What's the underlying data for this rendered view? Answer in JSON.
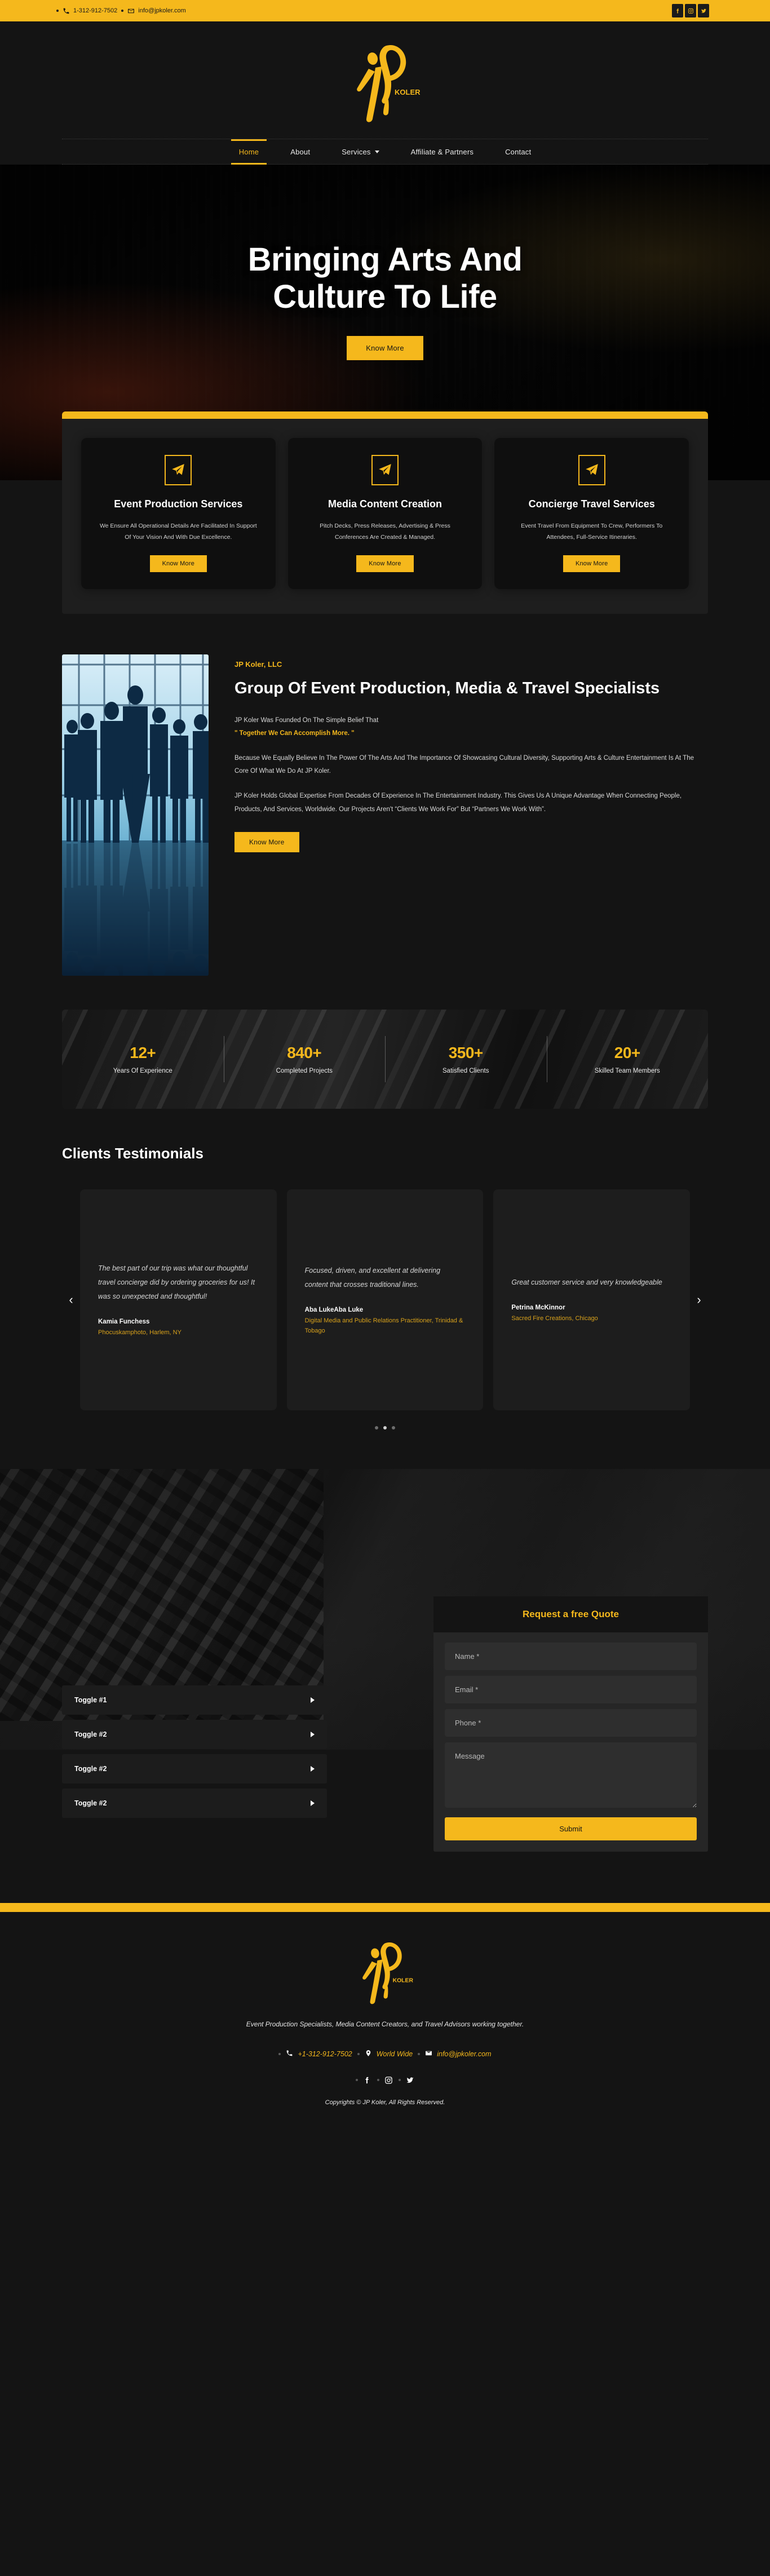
{
  "brand": {
    "name": "JP Koler",
    "logo_text": "KOLER",
    "accent": "#F5B81C"
  },
  "topbar": {
    "phone": "1-312-912-7502",
    "email": "info@jpkoler.com",
    "social": [
      {
        "name": "facebook",
        "label": "f"
      },
      {
        "name": "instagram",
        "label": "o"
      },
      {
        "name": "twitter",
        "label": "t"
      }
    ]
  },
  "nav": {
    "items": [
      {
        "label": "Home",
        "active": true
      },
      {
        "label": "About",
        "active": false
      },
      {
        "label": "Services",
        "active": false,
        "has_dropdown": true
      },
      {
        "label": "Affiliate & Partners",
        "active": false
      },
      {
        "label": "Contact",
        "active": false
      }
    ]
  },
  "hero": {
    "line1": "Bringing Arts And",
    "line2": "Culture To Life",
    "cta": "Know More"
  },
  "services": {
    "cards": [
      {
        "icon": "paper-plane-icon",
        "title": "Event Production Services",
        "desc": "We Ensure All Operational Details Are Facilitated In Support Of Your Vision And With Due Excellence.",
        "cta": "Know More"
      },
      {
        "icon": "paper-plane-icon",
        "title": "Media Content Creation",
        "desc": "Pitch Decks, Press Releases, Advertising & Press Conferences Are Created & Managed.",
        "cta": "Know More"
      },
      {
        "icon": "paper-plane-icon",
        "title": "Concierge Travel Services",
        "desc": "Event Travel From Equipment To Crew, Performers To Attendees, Full-Service Itineraries.",
        "cta": "Know More"
      }
    ]
  },
  "about": {
    "eyebrow": "JP Koler, LLC",
    "heading": "Group Of Event Production, Media & Travel Specialists",
    "intro_prefix": "JP Koler Was Founded On The Simple Belief That",
    "intro_quote": "\" Together We Can Accomplish More. \"",
    "paragraph2": "Because We Equally Believe In The Power Of The Arts And The Importance Of Showcasing Cultural Diversity, Supporting Arts & Culture Entertainment Is At The Core Of What We Do At JP Koler.",
    "paragraph3": "JP Koler Holds Global Expertise From Decades Of Experience In The Entertainment Industry. This Gives Us A Unique Advantage When Connecting People, Products, And Services, Worldwide. Our Projects Aren't “Clients We Work For” But “Partners We Work With”.",
    "cta": "Know More",
    "image_alt": "business-team-silhouette-photo"
  },
  "stats": {
    "items": [
      {
        "value": "12+",
        "label": "Years Of Experience"
      },
      {
        "value": "840+",
        "label": "Completed Projects"
      },
      {
        "value": "350+",
        "label": "Satisfied Clients"
      },
      {
        "value": "20+",
        "label": "Skilled Team Members"
      }
    ]
  },
  "testimonials": {
    "heading": "Clients Testimonials",
    "prev": "‹",
    "next": "›",
    "items": [
      {
        "quote": "The best part of our trip was what our thoughtful travel concierge did by ordering groceries for us! It was so unexpected and thoughtful!",
        "name": "Kamia Funchess",
        "role": "Phocuskamphoto, Harlem, NY"
      },
      {
        "quote": "Focused, driven, and excellent at delivering content that crosses traditional lines.",
        "name": "Aba LukeAba Luke",
        "role": "Digital Media and Public Relations Practitioner, Trinidad & Tobago"
      },
      {
        "quote": "Great customer service and very knowledgeable",
        "name": "Petrina McKinnor",
        "role": "Sacred Fire Creations, Chicago"
      }
    ],
    "dots": [
      false,
      true,
      false
    ]
  },
  "toggles": {
    "items": [
      {
        "label": "Toggle #1"
      },
      {
        "label": "Toggle #2"
      },
      {
        "label": "Toggle #2"
      },
      {
        "label": "Toggle #2"
      }
    ]
  },
  "quote_form": {
    "title": "Request a free Quote",
    "name_placeholder": "Name *",
    "email_placeholder": "Email *",
    "phone_placeholder": "Phone *",
    "message_placeholder": "Message",
    "submit": "Submit",
    "name_value": "",
    "email_value": "",
    "phone_value": "",
    "message_value": ""
  },
  "footer": {
    "tagline": "Event Production Specialists, Media Content Creators, and Travel Advisors working together.",
    "phone": "+1-312-912-7502",
    "location": "World Wide",
    "email": "info@jpkoler.com",
    "social": [
      {
        "name": "facebook"
      },
      {
        "name": "instagram"
      },
      {
        "name": "twitter"
      }
    ],
    "copyright": "Copyrights © JP Koler, All Rights Reserved."
  }
}
